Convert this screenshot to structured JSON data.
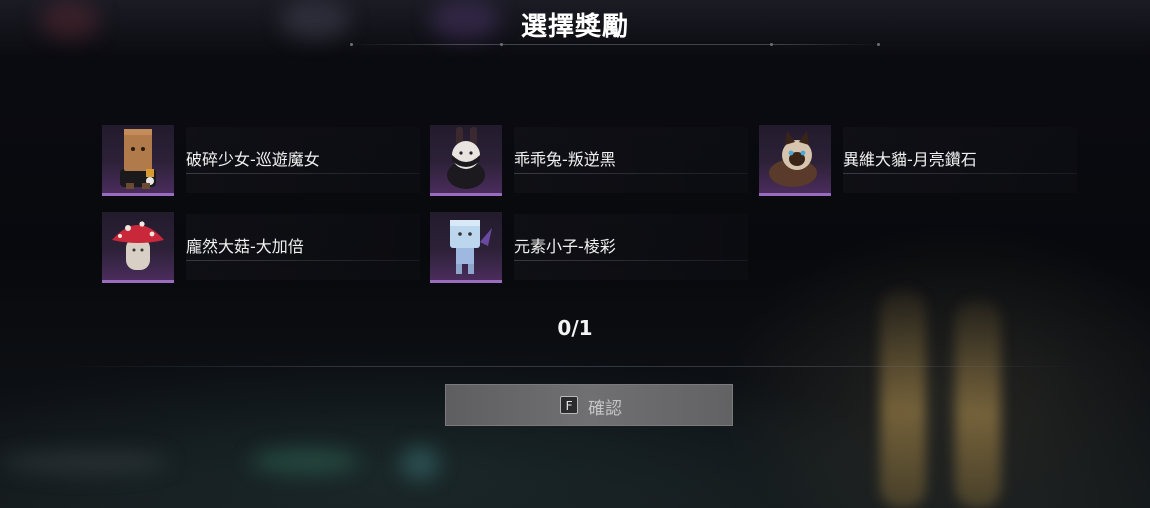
{
  "header": {
    "title": "選擇獎勵"
  },
  "rewards": [
    {
      "name": "破碎少女-巡遊魔女",
      "icon": "paper-bag-doll-icon"
    },
    {
      "name": "乖乖兔-叛逆黑",
      "icon": "bunny-doll-icon"
    },
    {
      "name": "異維大貓-月亮鑽石",
      "icon": "cat-doll-icon"
    },
    {
      "name": "龐然大菇-大加倍",
      "icon": "mushroom-doll-icon"
    },
    {
      "name": "元素小子-棱彩",
      "icon": "cube-kid-doll-icon"
    }
  ],
  "selection": {
    "counter": "0/1"
  },
  "confirm": {
    "key": "F",
    "label": "確認"
  },
  "colors": {
    "accent": "#9a6cc0",
    "thumb_bg": "#2d2138",
    "button_bg": "#707072"
  }
}
